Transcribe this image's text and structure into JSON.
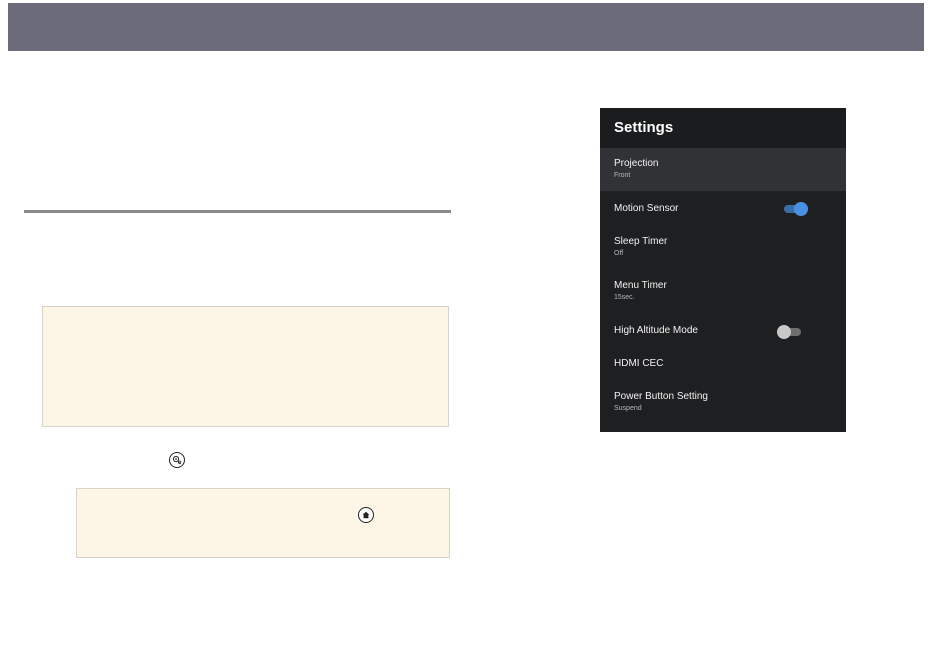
{
  "settings_panel": {
    "title": "Settings",
    "items": [
      {
        "label": "Projection",
        "sub": "Front",
        "selected": true
      },
      {
        "label": "Motion Sensor",
        "toggle": "on"
      },
      {
        "label": "Sleep Timer",
        "sub": "Off"
      },
      {
        "label": "Menu Timer",
        "sub": "15sec."
      },
      {
        "label": "High Altitude Mode",
        "toggle": "off"
      },
      {
        "label": "HDMI CEC"
      },
      {
        "label": "Power Button Setting",
        "sub": "Suspend"
      }
    ]
  },
  "icons": {
    "inline_1": "settings-icon",
    "inline_2": "home-icon"
  },
  "colors": {
    "banner": "#6b6b7a",
    "note_bg": "#fdf6e6",
    "panel_bg": "#1e1f21",
    "toggle_on": "#4a90e2"
  }
}
